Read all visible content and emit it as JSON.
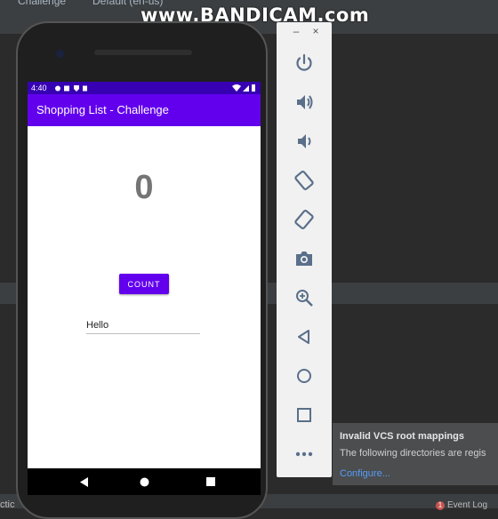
{
  "ide": {
    "run_config": "Challenge",
    "device_config": "Default (en-us)",
    "status_left": "ctic"
  },
  "watermark": "www.BANDICAM.com",
  "phone": {
    "status_time": "4:40",
    "app_title": "Shopping List - Challenge",
    "count_value": "0",
    "count_button_label": "COUNT",
    "edit_text_value": "Hello"
  },
  "emulator_toolbar": {
    "minimize_label": "–",
    "close_label": "×",
    "items": [
      "power-icon",
      "volume-up-icon",
      "volume-down-icon",
      "rotate-left-icon",
      "rotate-right-icon",
      "camera-icon",
      "zoom-icon",
      "back-icon",
      "home-icon",
      "overview-icon",
      "more-icon"
    ]
  },
  "notification": {
    "title": "Invalid VCS root mappings",
    "body": "The following directories are regis",
    "link": "Configure..."
  },
  "event_log": {
    "count": "1",
    "label": "Event Log"
  },
  "colors": {
    "primary": "#6200ee",
    "primary_dark": "#3700b3",
    "toolbar_icon": "#5a6f8a"
  }
}
